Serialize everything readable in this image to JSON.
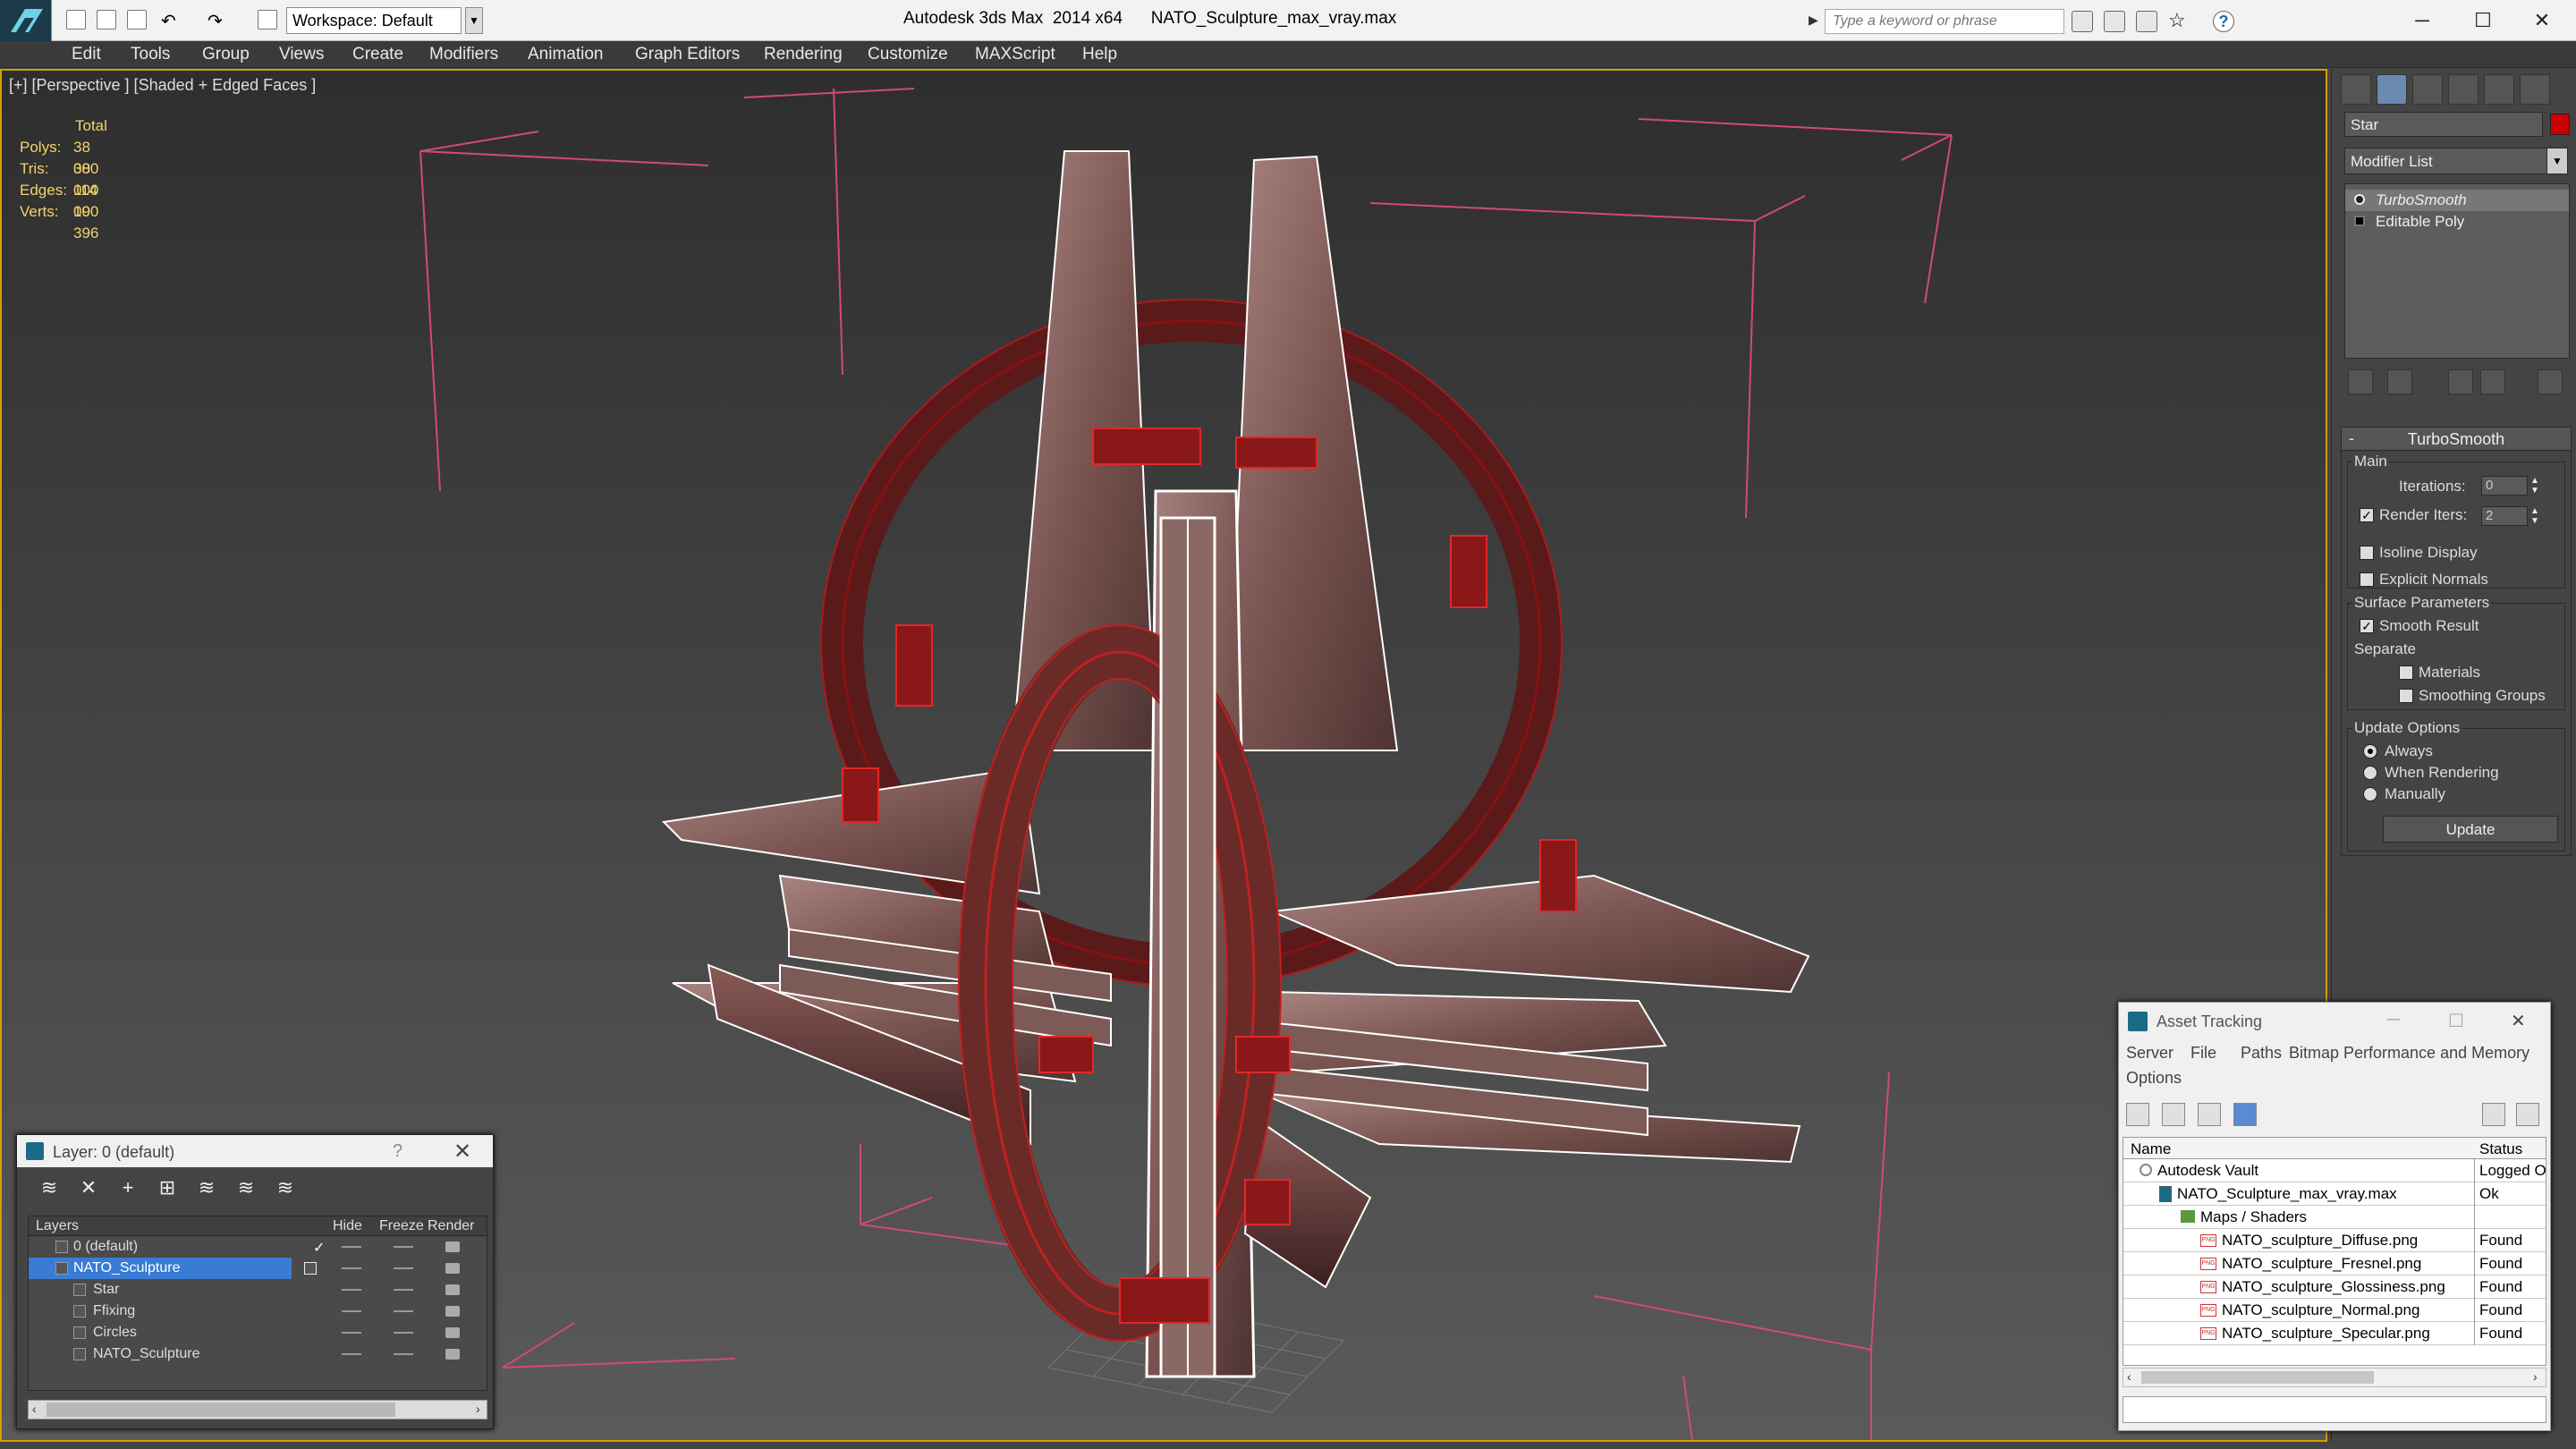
{
  "app": {
    "title": "Autodesk 3ds Max  2014 x64      NATO_Sculpture_max_vray.max"
  },
  "toolbar": {
    "workspace": "Workspace: Default",
    "search_placeholder": "Type a keyword or phrase"
  },
  "menu": [
    "Edit",
    "Tools",
    "Group",
    "Views",
    "Create",
    "Modifiers",
    "Animation",
    "Graph Editors",
    "Rendering",
    "Customize",
    "MAXScript",
    "Help"
  ],
  "viewport": {
    "label": "[+] [Perspective ] [Shaded + Edged Faces ]",
    "stats": {
      "header": "Total",
      "rows": [
        {
          "label": "Polys:",
          "value": "38 000"
        },
        {
          "label": "Tris:",
          "value": "38 000"
        },
        {
          "label": "Edges:",
          "value": "114 000"
        },
        {
          "label": "Verts:",
          "value": "19 396"
        }
      ]
    }
  },
  "command_panel": {
    "object_name": "Star",
    "object_color": "#cc0000",
    "modifier_list": "Modifier List",
    "stack": [
      "TurboSmooth",
      "Editable Poly"
    ],
    "turbosmooth": {
      "title": "TurboSmooth",
      "main_label": "Main",
      "iterations_label": "Iterations:",
      "iterations_value": "0",
      "render_iters_label": "Render Iters:",
      "render_iters_value": "2",
      "isoline": "Isoline Display",
      "explicit_normals": "Explicit Normals",
      "surface_label": "Surface Parameters",
      "smooth_result": "Smooth Result",
      "separate": "Separate",
      "materials": "Materials",
      "smoothing_groups": "Smoothing Groups",
      "update_options": "Update Options",
      "always": "Always",
      "when_rendering": "When Rendering",
      "manually": "Manually",
      "update_button": "Update"
    }
  },
  "layer_window": {
    "title": "Layer: 0 (default)",
    "help": "?",
    "columns": [
      "Layers",
      "Hide",
      "Freeze",
      "Render"
    ],
    "rows": [
      {
        "name": "0 (default)",
        "indent": 0,
        "selected": false,
        "check": "✓"
      },
      {
        "name": "NATO_Sculpture",
        "indent": 0,
        "selected": true,
        "check": ""
      },
      {
        "name": "Star",
        "indent": 1,
        "selected": false,
        "check": ""
      },
      {
        "name": "Ffixing",
        "indent": 1,
        "selected": false,
        "check": ""
      },
      {
        "name": "Circles",
        "indent": 1,
        "selected": false,
        "check": ""
      },
      {
        "name": "NATO_Sculpture",
        "indent": 1,
        "selected": false,
        "check": ""
      }
    ]
  },
  "asset_window": {
    "title": "Asset Tracking",
    "menu": [
      "Server",
      "File",
      "Paths",
      "Bitmap Performance and Memory",
      "Options"
    ],
    "columns": [
      "Name",
      "Status"
    ],
    "rows": [
      {
        "name": "Autodesk Vault",
        "status": "Logged O",
        "indent": 0,
        "icon": "vault"
      },
      {
        "name": "NATO_Sculpture_max_vray.max",
        "status": "Ok",
        "indent": 1,
        "icon": "max"
      },
      {
        "name": "Maps / Shaders",
        "status": "",
        "indent": 2,
        "icon": "maps"
      },
      {
        "name": "NATO_sculpture_Diffuse.png",
        "status": "Found",
        "indent": 3,
        "icon": "png"
      },
      {
        "name": "NATO_sculpture_Fresnel.png",
        "status": "Found",
        "indent": 3,
        "icon": "png"
      },
      {
        "name": "NATO_sculpture_Glossiness.png",
        "status": "Found",
        "indent": 3,
        "icon": "png"
      },
      {
        "name": "NATO_sculpture_Normal.png",
        "status": "Found",
        "indent": 3,
        "icon": "png"
      },
      {
        "name": "NATO_sculpture_Specular.png",
        "status": "Found",
        "indent": 3,
        "icon": "png"
      }
    ]
  }
}
